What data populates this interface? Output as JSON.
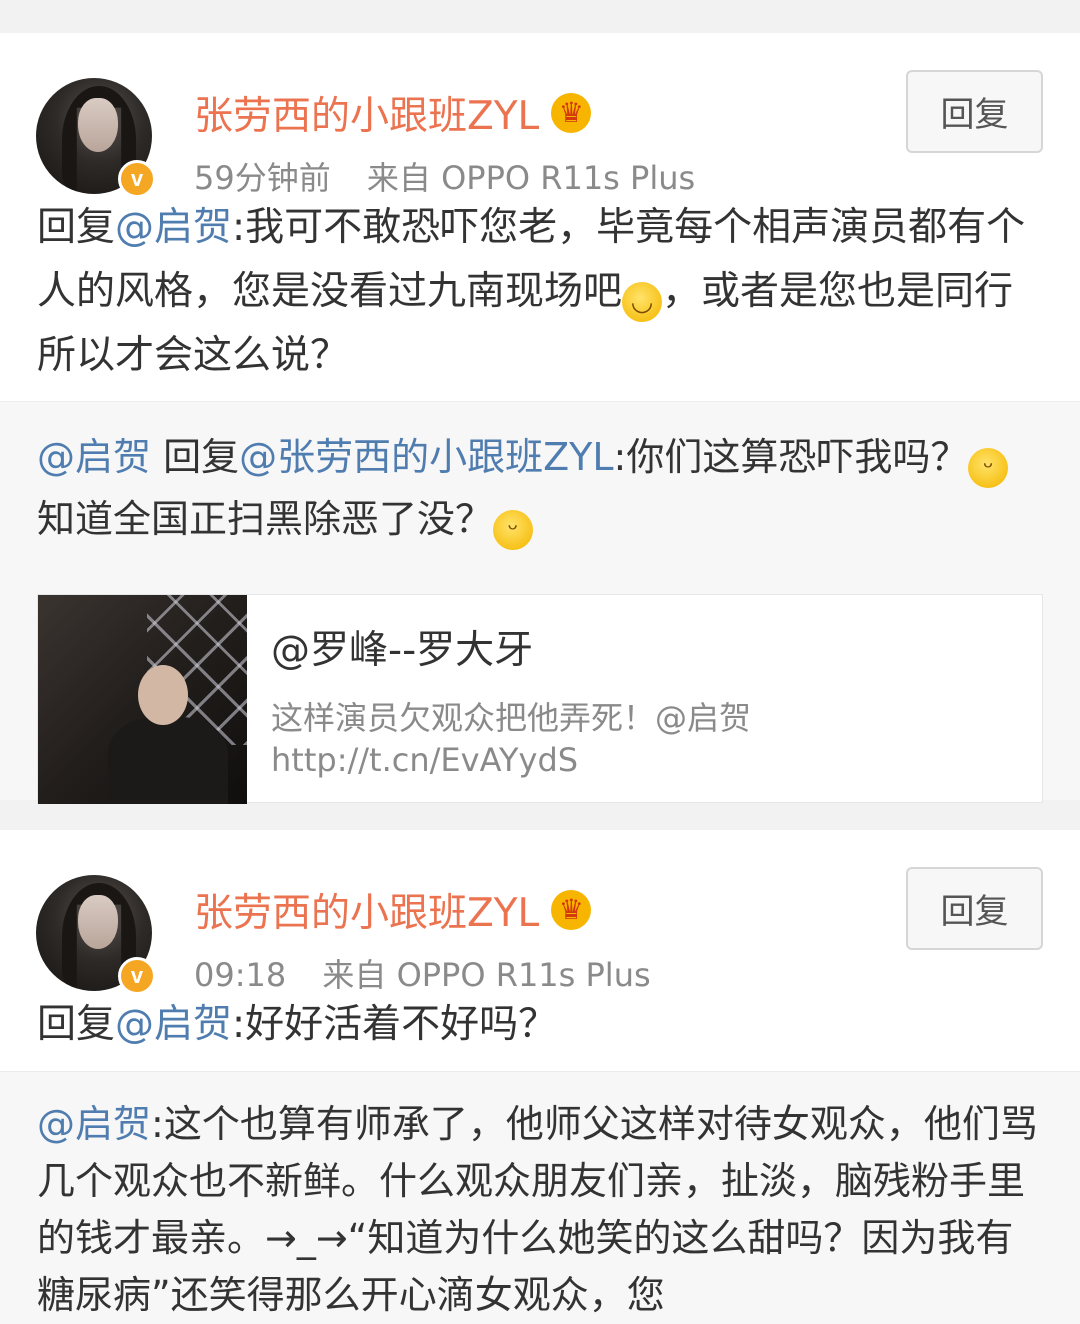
{
  "comments": [
    {
      "username": "张劳西的小跟班ZYL",
      "crown_icon": "crown-icon",
      "verified_badge": "v",
      "time": "59分钟前",
      "source": "来自 OPPO R11s Plus",
      "reply_button": "回复",
      "text_prefix": "回复",
      "mention": "@启贺",
      "text_part1": ":我可不敢恐吓您老，毕竟每个相声演员都有个人的风格，您是没看过九南现场吧",
      "text_part2": "，或者是您也是同行所以才会这么说？",
      "original": {
        "author": "@启贺",
        "reply_word": " 回复",
        "reply_to": "@张劳西的小跟班ZYL",
        "text_part1": ":你们这算恐吓我吗？",
        "text_part2": "知道全国正扫黑除恶了没？",
        "link_card": {
          "title": "@罗峰--罗大牙",
          "description": "这样演员欠观众把他弄死！@启贺",
          "url": "http://t.cn/EvAYydS"
        }
      }
    },
    {
      "username": "张劳西的小跟班ZYL",
      "crown_icon": "crown-icon",
      "verified_badge": "v",
      "time": "09:18",
      "source": "来自 OPPO R11s Plus",
      "reply_button": "回复",
      "text_prefix": "回复",
      "mention": "@启贺",
      "text": ":好好活着不好吗？",
      "original": {
        "author": "@启贺",
        "text": ":这个也算有师承了，他师父这样对待女观众，他们骂几个观众也不新鲜。什么观众朋友们亲，扯淡，脑残粉手里的钱才最亲。→_→“知道为什么她笑的这么甜吗？因为我有糖尿病”还笑得那么开心滴女观众，您"
      }
    }
  ],
  "colors": {
    "username": "#eb7350",
    "mention": "#507daf",
    "verified": "#f5a623"
  }
}
